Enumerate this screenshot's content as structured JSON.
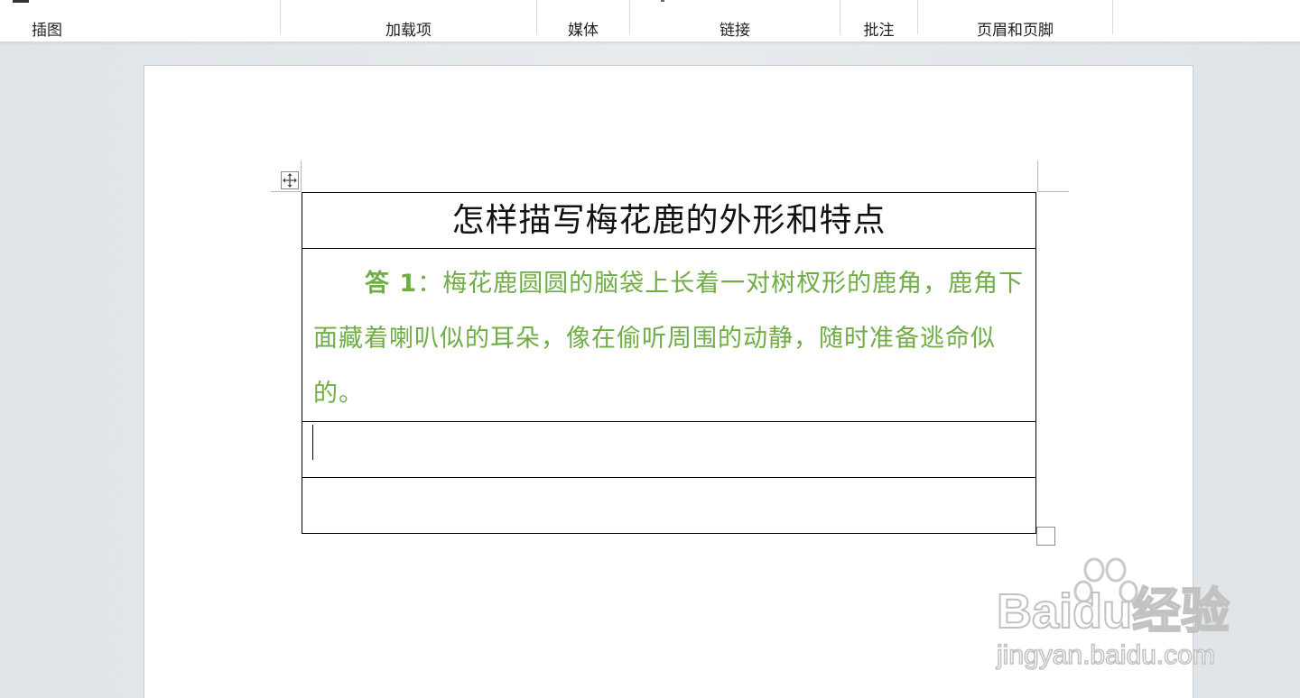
{
  "ribbon": {
    "groups": [
      {
        "label": "插图"
      },
      {
        "label": "加载项"
      },
      {
        "label": "媒体"
      },
      {
        "label": "链接"
      },
      {
        "label": "批注"
      },
      {
        "label": "页眉和页脚"
      }
    ]
  },
  "document": {
    "table": {
      "title": "怎样描写梅花鹿的外形和特点",
      "answer_label": "答 1",
      "answer_colon": "：",
      "answer_text": "梅花鹿圆圆的脑袋上长着一对树杈形的鹿角，鹿角下面藏着喇叭似的耳朵，像在偷听周围的动静，随时准备逃命似的。",
      "answer_color": "#70ad47"
    }
  },
  "watermark": {
    "brand": "Baidu经验",
    "url": "jingyan.baidu.com"
  },
  "icons": {
    "table_move": "move-arrows-icon",
    "table_resize": "resize-square-icon",
    "watermark_paw": "paw-icon"
  }
}
